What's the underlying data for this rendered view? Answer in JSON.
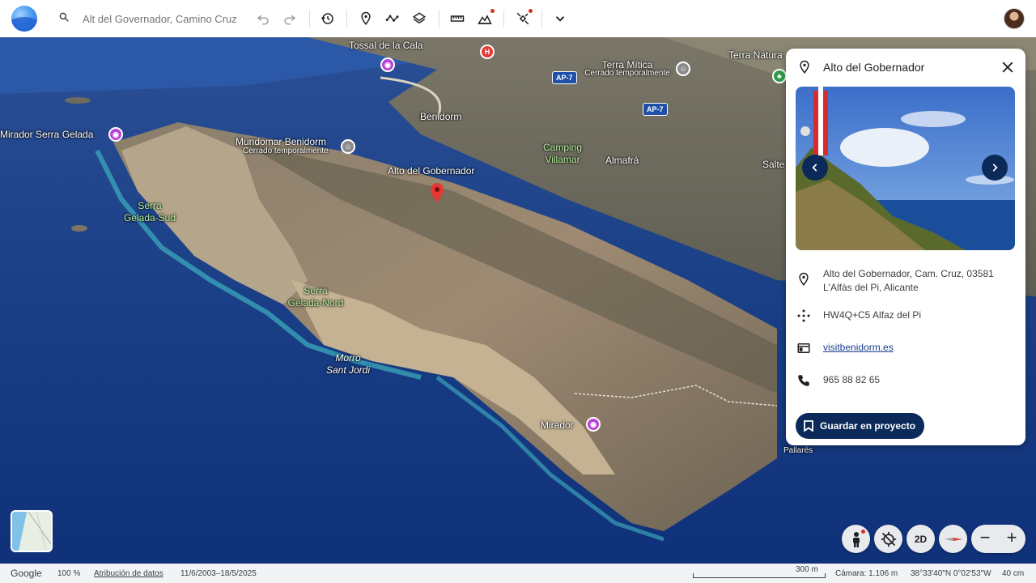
{
  "search": {
    "placeholder": "Alt del Governador, Camino Cruz"
  },
  "toolbar": {
    "icons": [
      "search-icon",
      "undo-icon",
      "redo-icon",
      "history-icon",
      "place-pin-icon",
      "path-icon",
      "layers-icon",
      "ruler-icon",
      "elevation-icon",
      "satellite-icon",
      "chevron-down-icon"
    ]
  },
  "map_labels": {
    "tossal": "Tossal de la Cala",
    "terra_mitica": "Terra Mítica",
    "terra_mitica_status": "Cerrado temporalmente",
    "terra_natura": "Terra Natura",
    "benidorm": "Benidorm",
    "mirador_gelada": "Mirador Serra Gelada",
    "mundomar": "Mundomar Benidorm",
    "mundomar_status": "Cerrado temporalmente",
    "camping_1": "Camping",
    "camping_2": "Villamar",
    "almafra": "Almafrá",
    "salte": "Salte",
    "alto": "Alto del Gobernador",
    "serra_sud_1": "Serra",
    "serra_sud_2": "Gelada-Sud",
    "serra_nord_1": "Serra",
    "serra_nord_2": "Gelada-Nord",
    "morro_1": "Morro",
    "morro_2": "Sant Jordi",
    "mirador": "Mirador",
    "pallares": "Pallarés",
    "ap7_a": "AP-7",
    "ap7_b": "AP-7",
    "hospital": "H"
  },
  "panel": {
    "title": "Alto del Gobernador",
    "address_line1": "Alto del Gobernador, Cam. Cruz, 03581",
    "address_line2": "L'Alfàs del Pi, Alicante",
    "plus_code": "HW4Q+C5 Alfaz del Pi",
    "website": "visitbenidorm.es",
    "phone": "965 88 82 65",
    "save_label": "Guardar en proyecto"
  },
  "controls": {
    "mode_2d": "2D",
    "zoom_out": "−",
    "zoom_in": "+"
  },
  "status": {
    "google": "Google",
    "zoom": "100 %",
    "attribution": "Atribución de datos",
    "dates": "11/6/2003–18/5/2025",
    "scale": "300 m",
    "camera": "Cámara: 1.106 m",
    "coords": "38°33'40\"N 0°02'53\"W",
    "elevation": "40 cm"
  },
  "colors": {
    "accent": "#0b2a5a",
    "pin_red": "#e53935",
    "poi_purple": "#b645d4"
  }
}
